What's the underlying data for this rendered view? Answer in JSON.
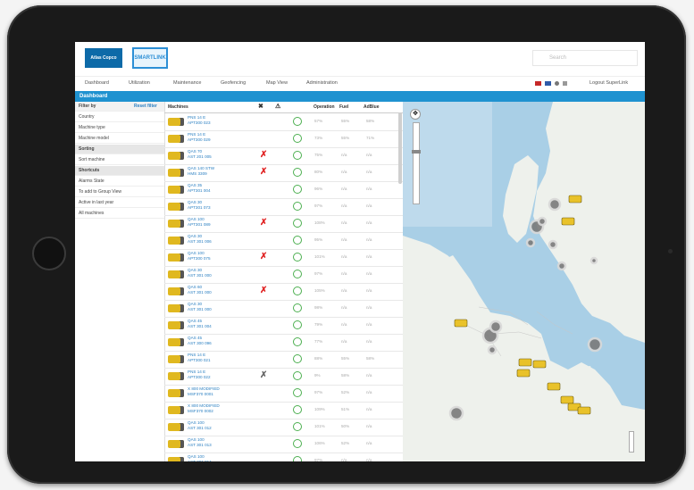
{
  "brand": {
    "logo_text": "Atlas Copco",
    "app_logo_text": "SMARTLINK"
  },
  "search": {
    "placeholder": "Search"
  },
  "nav": {
    "items": [
      "Dashboard",
      "Utilization",
      "Maintenance",
      "Geofencing",
      "Map View",
      "Administration"
    ],
    "logout": "Logout SuperLink"
  },
  "page": {
    "title": "Dashboard"
  },
  "sidebar": {
    "filter_label": "Filter by",
    "reset_label": "Reset filter",
    "rows": [
      {
        "label": "Country",
        "header": false
      },
      {
        "label": "Machine type",
        "header": false
      },
      {
        "label": "Machine model",
        "header": false
      },
      {
        "label": "Sorting",
        "header": true
      },
      {
        "label": "Sort machine",
        "header": false
      },
      {
        "label": "Shortcuts",
        "header": true
      },
      {
        "label": "Alarms State",
        "header": false
      },
      {
        "label": "To add to Group View",
        "header": false
      },
      {
        "label": "Active in last year",
        "header": false
      },
      {
        "label": "All machines",
        "header": false
      }
    ]
  },
  "table": {
    "headers": {
      "machines": "Machines",
      "operation": "Operation",
      "fuel": "Fuel",
      "adblue": "AdBlue"
    },
    "rows": [
      {
        "name": "PNS 14 E",
        "serial": "APT300 023",
        "alarm": "none",
        "op": "57%",
        "fuel": "55%",
        "ad": "58%"
      },
      {
        "name": "PNS 14 E",
        "serial": "APT300 029",
        "alarm": "none",
        "op": "73%",
        "fuel": "55%",
        "ad": "71%"
      },
      {
        "name": "QAS 70",
        "serial": "AST 201 005",
        "alarm": "red",
        "op": "75%",
        "fuel": "n/a",
        "ad": "n/a"
      },
      {
        "name": "QAS 140 STW",
        "serial": "HMS 3309",
        "alarm": "red",
        "op": "80%",
        "fuel": "n/a",
        "ad": "n/a"
      },
      {
        "name": "QAS 35",
        "serial": "APT301 004",
        "alarm": "none",
        "op": "96%",
        "fuel": "n/a",
        "ad": "n/a"
      },
      {
        "name": "QAS 30",
        "serial": "APT301 073",
        "alarm": "none",
        "op": "97%",
        "fuel": "n/a",
        "ad": "n/a"
      },
      {
        "name": "QAS 100",
        "serial": "APT301 089",
        "alarm": "red",
        "op": "108%",
        "fuel": "n/a",
        "ad": "n/a"
      },
      {
        "name": "QAS 30",
        "serial": "AST 301 006",
        "alarm": "none",
        "op": "95%",
        "fuel": "n/a",
        "ad": "n/a"
      },
      {
        "name": "QAS 100",
        "serial": "APT300 075",
        "alarm": "red",
        "op": "101%",
        "fuel": "n/a",
        "ad": "n/a"
      },
      {
        "name": "QAS 30",
        "serial": "AST 301 000",
        "alarm": "none",
        "op": "97%",
        "fuel": "n/a",
        "ad": "n/a"
      },
      {
        "name": "QAS 60",
        "serial": "AST 301 000",
        "alarm": "red",
        "op": "105%",
        "fuel": "n/a",
        "ad": "n/a"
      },
      {
        "name": "QAS 30",
        "serial": "AST 301 000",
        "alarm": "none",
        "op": "98%",
        "fuel": "n/a",
        "ad": "n/a"
      },
      {
        "name": "QAS 45",
        "serial": "AST 301 004",
        "alarm": "none",
        "op": "79%",
        "fuel": "n/a",
        "ad": "n/a"
      },
      {
        "name": "QAS 45",
        "serial": "AST 300 096",
        "alarm": "none",
        "op": "77%",
        "fuel": "n/a",
        "ad": "n/a"
      },
      {
        "name": "PNS 14 E",
        "serial": "APT300 021",
        "alarm": "none",
        "op": "88%",
        "fuel": "55%",
        "ad": "58%"
      },
      {
        "name": "PNS 14 E",
        "serial": "APT300 022",
        "alarm": "grey",
        "op": "9%",
        "fuel": "58%",
        "ad": "n/a"
      },
      {
        "name": "X 800 MODIFIED",
        "serial": "MSF370 0001",
        "alarm": "none",
        "op": "97%",
        "fuel": "52%",
        "ad": "n/a"
      },
      {
        "name": "X 800 MODIFIED",
        "serial": "MSF370 0002",
        "alarm": "none",
        "op": "109%",
        "fuel": "51%",
        "ad": "n/a"
      },
      {
        "name": "QAS 100",
        "serial": "AST 301 012",
        "alarm": "none",
        "op": "101%",
        "fuel": "50%",
        "ad": "n/a"
      },
      {
        "name": "QAS 100",
        "serial": "AST 301 013",
        "alarm": "none",
        "op": "106%",
        "fuel": "52%",
        "ad": "n/a"
      },
      {
        "name": "QAS 100",
        "serial": "AST 301 014",
        "alarm": "none",
        "op": "97%",
        "fuel": "n/a",
        "ad": "n/a"
      }
    ]
  },
  "colors": {
    "accent": "#1f92d0",
    "alarm": "#e02222",
    "ok": "#4caf50",
    "machine": "#e9c22a",
    "water": "#a9cfe6",
    "land": "#eef1ec"
  },
  "icons": {
    "search": "search-icon",
    "zoom_in": "zoom-in-icon",
    "zoom_out": "zoom-out-icon",
    "status": "power-status-icon",
    "alarm": "wrench-alarm-icon",
    "warning": "warning-icon"
  }
}
